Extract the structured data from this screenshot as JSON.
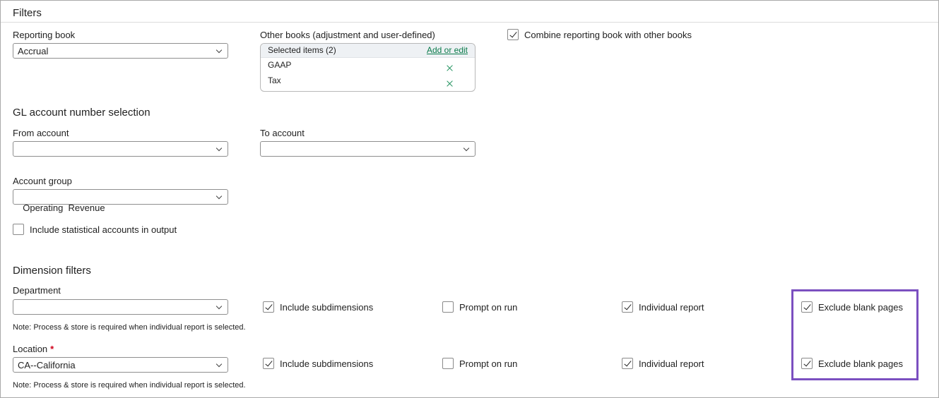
{
  "panel": {
    "title": "Filters"
  },
  "reporting_book": {
    "label": "Reporting book",
    "value": "Accrual"
  },
  "other_books": {
    "label": "Other books (adjustment and user-defined)",
    "selected_count": "Selected items (2)",
    "add_edit": "Add or edit",
    "items": [
      "GAAP",
      "Tax"
    ]
  },
  "combine": {
    "label": "Combine reporting book with other books",
    "checked": true
  },
  "gl_section": {
    "title": "GL account number selection"
  },
  "from_account": {
    "label": "From account",
    "value": ""
  },
  "to_account": {
    "label": "To account",
    "value": ""
  },
  "account_group": {
    "label": "Account group",
    "value": "Operating  Revenue"
  },
  "include_statistical": {
    "label": "Include statistical accounts in output",
    "checked": false
  },
  "dimension_section": {
    "title": "Dimension filters"
  },
  "department": {
    "label": "Department",
    "value": "",
    "include_subdimensions": "Include subdimensions",
    "prompt_on_run": "Prompt on run",
    "individual_report": "Individual report",
    "exclude_blank_pages": "Exclude blank pages",
    "note": "Note: Process & store is required when individual report is selected."
  },
  "location": {
    "label": "Location",
    "required_mark": "*",
    "value": "CA--California",
    "include_subdimensions": "Include subdimensions",
    "prompt_on_run": "Prompt on run",
    "individual_report": "Individual report",
    "exclude_blank_pages": "Exclude blank pages",
    "note": "Note: Process & store is required when individual report is selected."
  },
  "colors": {
    "highlight": "#7b4fc0",
    "link": "#0a7b4b",
    "remove_icon": "#1b8f5a",
    "required": "#d0021b"
  }
}
